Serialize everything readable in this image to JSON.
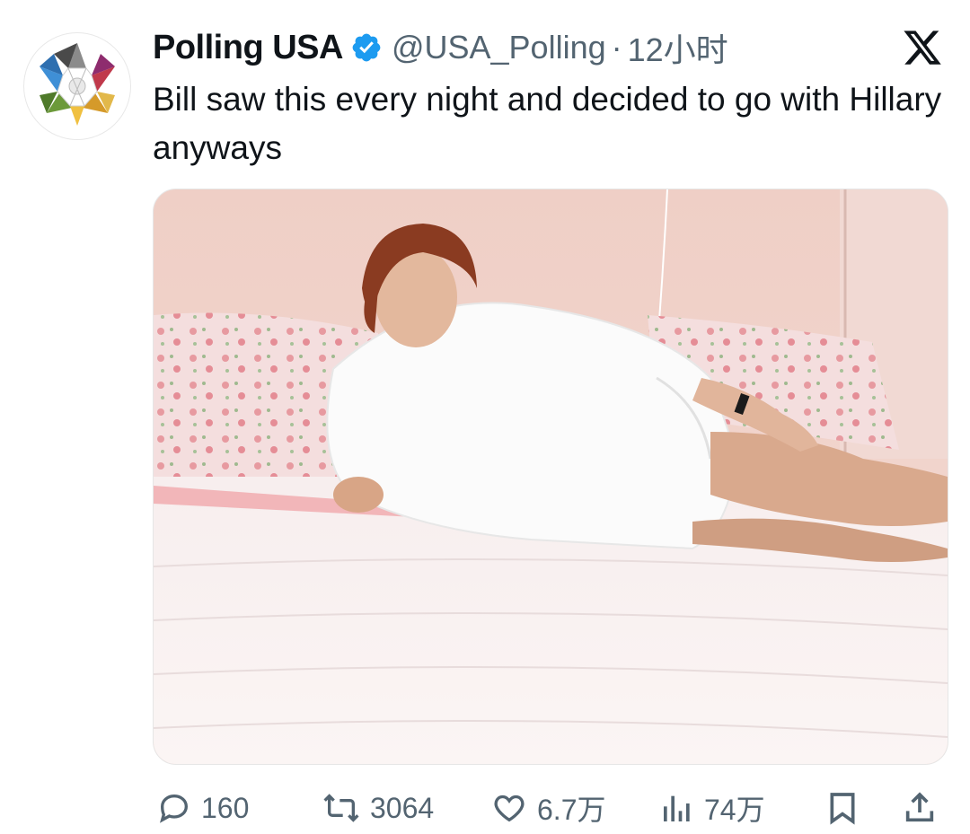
{
  "author": {
    "display_name": "Polling USA",
    "handle": "@USA_Polling",
    "separator": "·",
    "time": "12小时",
    "verified": true,
    "avatar_icon": "star-logo-avatar"
  },
  "platform_icon": "x-logo-icon",
  "tweet": {
    "text": "Bill saw this every night and decided to go with Hillary anyways"
  },
  "media": {
    "type": "photo",
    "alt_icon": "bedroom-photo"
  },
  "actions": {
    "replies": "160",
    "retweets": "3064",
    "likes": "6.7万",
    "views": "74万"
  },
  "colors": {
    "text_primary": "#0f1419",
    "text_secondary": "#536471",
    "verified_blue": "#1d9bf0"
  }
}
